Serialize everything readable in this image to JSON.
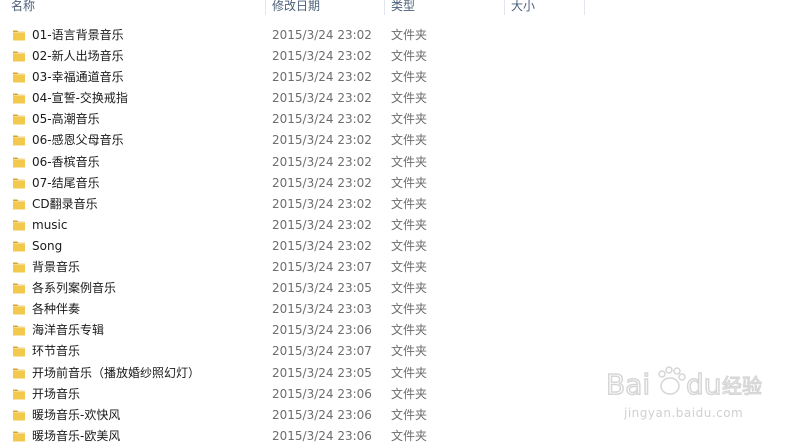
{
  "columns": {
    "name": "名称",
    "date": "修改日期",
    "type": "类型",
    "size": "大小"
  },
  "icon": "folder-icon",
  "colors": {
    "folder_body": "#f2c94c",
    "folder_tab": "#d9a52a",
    "header_text": "#4c607a"
  },
  "files": [
    {
      "name": "01-语言背景音乐",
      "date": "2015/3/24 23:02",
      "type": "文件夹"
    },
    {
      "name": "02-新人出场音乐",
      "date": "2015/3/24 23:02",
      "type": "文件夹"
    },
    {
      "name": "03-幸福通道音乐",
      "date": "2015/3/24 23:02",
      "type": "文件夹"
    },
    {
      "name": "04-宣誓-交换戒指",
      "date": "2015/3/24 23:02",
      "type": "文件夹"
    },
    {
      "name": "05-高潮音乐",
      "date": "2015/3/24 23:02",
      "type": "文件夹"
    },
    {
      "name": "06-感恩父母音乐",
      "date": "2015/3/24 23:02",
      "type": "文件夹"
    },
    {
      "name": "06-香槟音乐",
      "date": "2015/3/24 23:02",
      "type": "文件夹"
    },
    {
      "name": "07-结尾音乐",
      "date": "2015/3/24 23:02",
      "type": "文件夹"
    },
    {
      "name": "CD翻录音乐",
      "date": "2015/3/24 23:02",
      "type": "文件夹"
    },
    {
      "name": "music",
      "date": "2015/3/24 23:02",
      "type": "文件夹"
    },
    {
      "name": "Song",
      "date": "2015/3/24 23:02",
      "type": "文件夹"
    },
    {
      "name": "背景音乐",
      "date": "2015/3/24 23:07",
      "type": "文件夹"
    },
    {
      "name": "各系列案例音乐",
      "date": "2015/3/24 23:05",
      "type": "文件夹"
    },
    {
      "name": "各种伴奏",
      "date": "2015/3/24 23:03",
      "type": "文件夹"
    },
    {
      "name": "海洋音乐专辑",
      "date": "2015/3/24 23:06",
      "type": "文件夹"
    },
    {
      "name": "环节音乐",
      "date": "2015/3/24 23:07",
      "type": "文件夹"
    },
    {
      "name": "开场前音乐（播放婚纱照幻灯）",
      "date": "2015/3/24 23:05",
      "type": "文件夹"
    },
    {
      "name": "开场音乐",
      "date": "2015/3/24 23:06",
      "type": "文件夹"
    },
    {
      "name": "暖场音乐-欢快风",
      "date": "2015/3/24 23:06",
      "type": "文件夹"
    },
    {
      "name": "暖场音乐-欧美风",
      "date": "2015/3/24 23:06",
      "type": "文件夹"
    }
  ],
  "watermark": {
    "text": "Baidu经验",
    "url": "jingyan.baidu.com"
  }
}
